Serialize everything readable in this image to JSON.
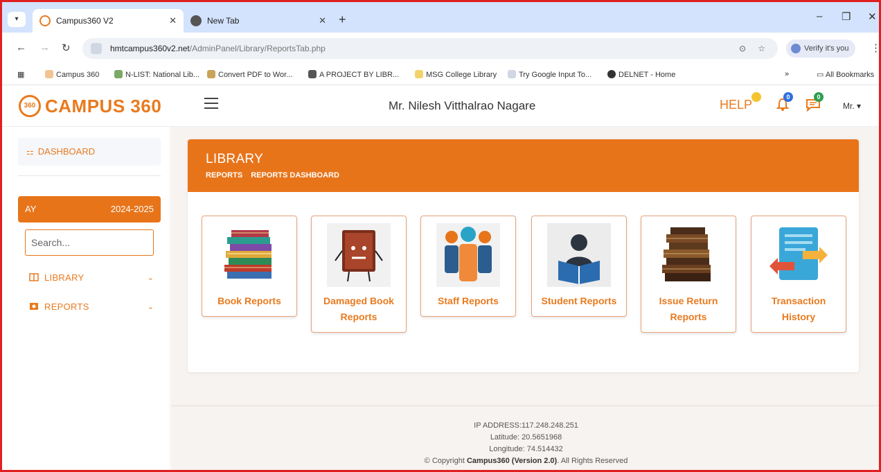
{
  "browser": {
    "tabs": [
      {
        "title": "Campus360 V2",
        "close": "✕"
      },
      {
        "title": "New Tab",
        "close": "✕"
      }
    ],
    "new_tab": "+",
    "url_host": "hmtcampus360v2.net",
    "url_path": "/AdminPanel/Library/ReportsTab.php",
    "verify": "Verify it's you",
    "bookmarks": [
      "Campus 360",
      "N-LIST: National Lib...",
      "Convert PDF to Wor...",
      "A PROJECT BY LIBR...",
      "MSG College Library",
      "Try Google Input To...",
      "DELNET - Home"
    ],
    "all_bookmarks": "All Bookmarks",
    "more": "»"
  },
  "header": {
    "logo_text": "CAMPUS 360",
    "logo_badge": "360",
    "user_name": "Mr. Nilesh Vitthalrao Nagare",
    "help": "HELP",
    "notif_count": "0",
    "msg_count": "0",
    "user_short": "Mr. ▾"
  },
  "sidebar": {
    "dashboard": "DASHBOARD",
    "ay_label": "AY",
    "ay_value": "2024-2025",
    "search_placeholder": "Search...",
    "items": [
      {
        "label": "LIBRARY"
      },
      {
        "label": "REPORTS"
      }
    ]
  },
  "main": {
    "title": "LIBRARY",
    "breadcrumbs": [
      "REPORTS",
      "REPORTS DASHBOARD"
    ],
    "cards": [
      {
        "label": "Book Reports",
        "icon": "books-stack-icon"
      },
      {
        "label": "Damaged Book Reports",
        "icon": "damaged-book-icon"
      },
      {
        "label": "Staff Reports",
        "icon": "staff-group-icon"
      },
      {
        "label": "Student Reports",
        "icon": "student-reading-icon"
      },
      {
        "label": "Issue Return Reports",
        "icon": "old-books-icon"
      },
      {
        "label": "Transaction History",
        "icon": "transaction-document-icon"
      }
    ]
  },
  "footer": {
    "ip": "IP ADDRESS:117.248.248.251",
    "latitude": "Latitude: 20.5651968",
    "longitude": "Longitude: 74.514432",
    "copyright_pre": "© Copyright",
    "copyright_brand": "Campus360 (Version 2.0)",
    "copyright_post": ". All Rights Reserved"
  },
  "colors": {
    "accent": "#e8741a",
    "brand_text": "#e97a1e",
    "browser_frame": "#d3e3fd"
  }
}
